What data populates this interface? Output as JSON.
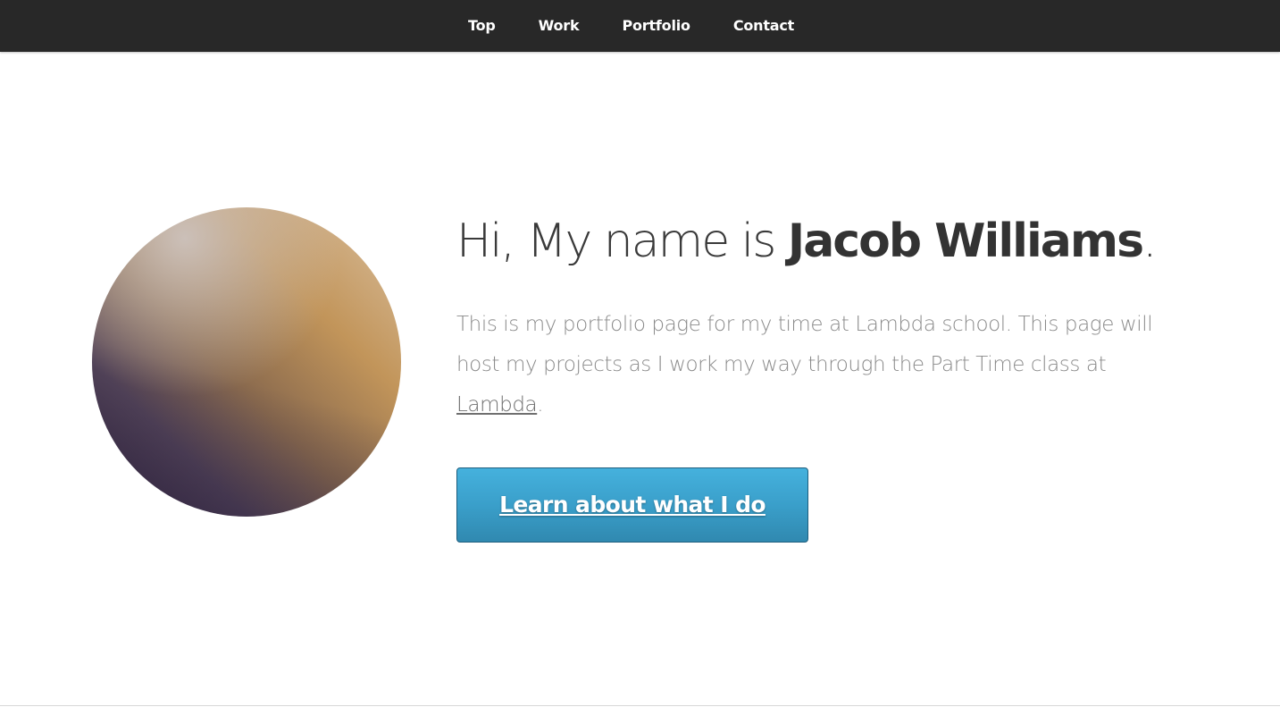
{
  "nav": {
    "items": [
      {
        "label": "Top"
      },
      {
        "label": "Work"
      },
      {
        "label": "Portfolio"
      },
      {
        "label": "Contact"
      }
    ]
  },
  "hero": {
    "headline_prefix": "Hi, My name is ",
    "name": "Jacob Williams",
    "headline_suffix": ".",
    "description_text": "This is my portfolio page for my time at Lambda school. This page will host my projects as I work my way through the Part Time class at ",
    "description_link": "Lambda",
    "description_end": ".",
    "cta_label": "Learn about what I do"
  },
  "colors": {
    "nav_background": "#282828",
    "button_accent": "#3a9fca",
    "heading_text": "#333333",
    "body_text": "#8a8a8a"
  }
}
